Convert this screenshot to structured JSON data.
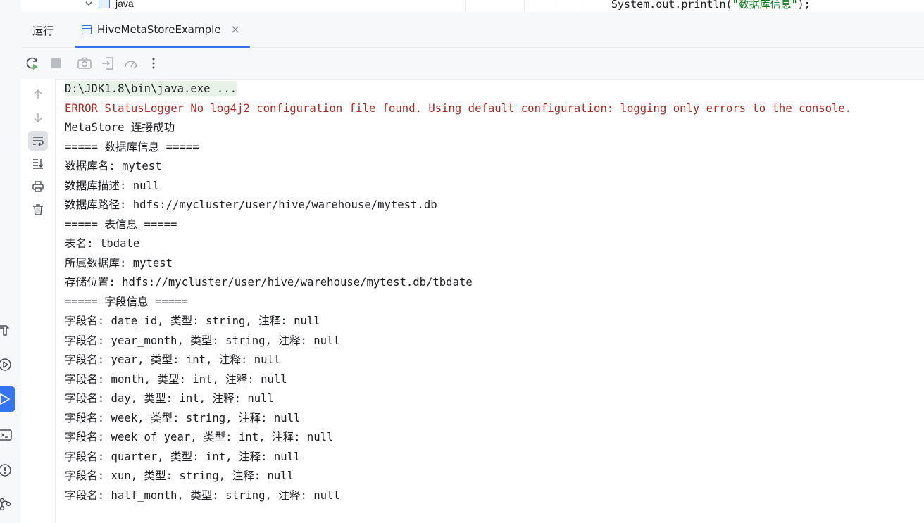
{
  "editor_peek": {
    "tree_node_label": "java",
    "code_prefix": "System.out.println(",
    "code_string": "\"数据库信息\"",
    "code_suffix": ");"
  },
  "run_panel": {
    "label": "运行",
    "tab_title": "HiveMetaStoreExample",
    "tab_close": "×"
  },
  "toolbar": {
    "icons": [
      "rerun-icon",
      "stop-icon",
      "camera-icon",
      "exit-icon",
      "dashboard-icon",
      "more-vertical-icon"
    ]
  },
  "side_gutter": {
    "icons": [
      "arrow-up-icon",
      "arrow-down-icon",
      "soft-wrap-icon",
      "scroll-to-end-icon",
      "print-icon",
      "trash-icon"
    ],
    "selected": "soft-wrap-icon"
  },
  "left_strip": {
    "icons": [
      "build-hammer-icon",
      "services-icon",
      "run-icon",
      "terminal-icon",
      "problems-icon",
      "git-icon"
    ],
    "active": "run-icon"
  },
  "console": {
    "lines": [
      {
        "type": "cmd",
        "text": "D:\\JDK1.8\\bin\\java.exe ..."
      },
      {
        "type": "error",
        "text": "ERROR StatusLogger No log4j2 configuration file found. Using default configuration: logging only errors to the console."
      },
      {
        "type": "normal",
        "text": "MetaStore 连接成功"
      },
      {
        "type": "normal",
        "text": "===== 数据库信息 ====="
      },
      {
        "type": "normal",
        "text": "数据库名: mytest"
      },
      {
        "type": "normal",
        "text": "数据库描述: null"
      },
      {
        "type": "normal",
        "text": "数据库路径: hdfs://mycluster/user/hive/warehouse/mytest.db"
      },
      {
        "type": "normal",
        "text": "===== 表信息 ====="
      },
      {
        "type": "normal",
        "text": "表名: tbdate"
      },
      {
        "type": "normal",
        "text": "所属数据库: mytest"
      },
      {
        "type": "normal",
        "text": "存储位置: hdfs://mycluster/user/hive/warehouse/mytest.db/tbdate"
      },
      {
        "type": "normal",
        "text": "===== 字段信息 ====="
      },
      {
        "type": "normal",
        "text": "字段名: date_id, 类型: string, 注释: null"
      },
      {
        "type": "normal",
        "text": "字段名: year_month, 类型: string, 注释: null"
      },
      {
        "type": "normal",
        "text": "字段名: year, 类型: int, 注释: null"
      },
      {
        "type": "normal",
        "text": "字段名: month, 类型: int, 注释: null"
      },
      {
        "type": "normal",
        "text": "字段名: day, 类型: int, 注释: null"
      },
      {
        "type": "normal",
        "text": "字段名: week, 类型: string, 注释: null"
      },
      {
        "type": "normal",
        "text": "字段名: week_of_year, 类型: int, 注释: null"
      },
      {
        "type": "normal",
        "text": "字段名: quarter, 类型: int, 注释: null"
      },
      {
        "type": "normal",
        "text": "字段名: xun, 类型: string, 注释: null"
      },
      {
        "type": "normal",
        "text": "字段名: half_month, 类型: string, 注释: null"
      }
    ]
  },
  "colors": {
    "accent": "#3574f0",
    "error_text": "#b3261e",
    "cmd_highlight": "#e6f2e6",
    "panel_bg": "#f7f8fa"
  }
}
